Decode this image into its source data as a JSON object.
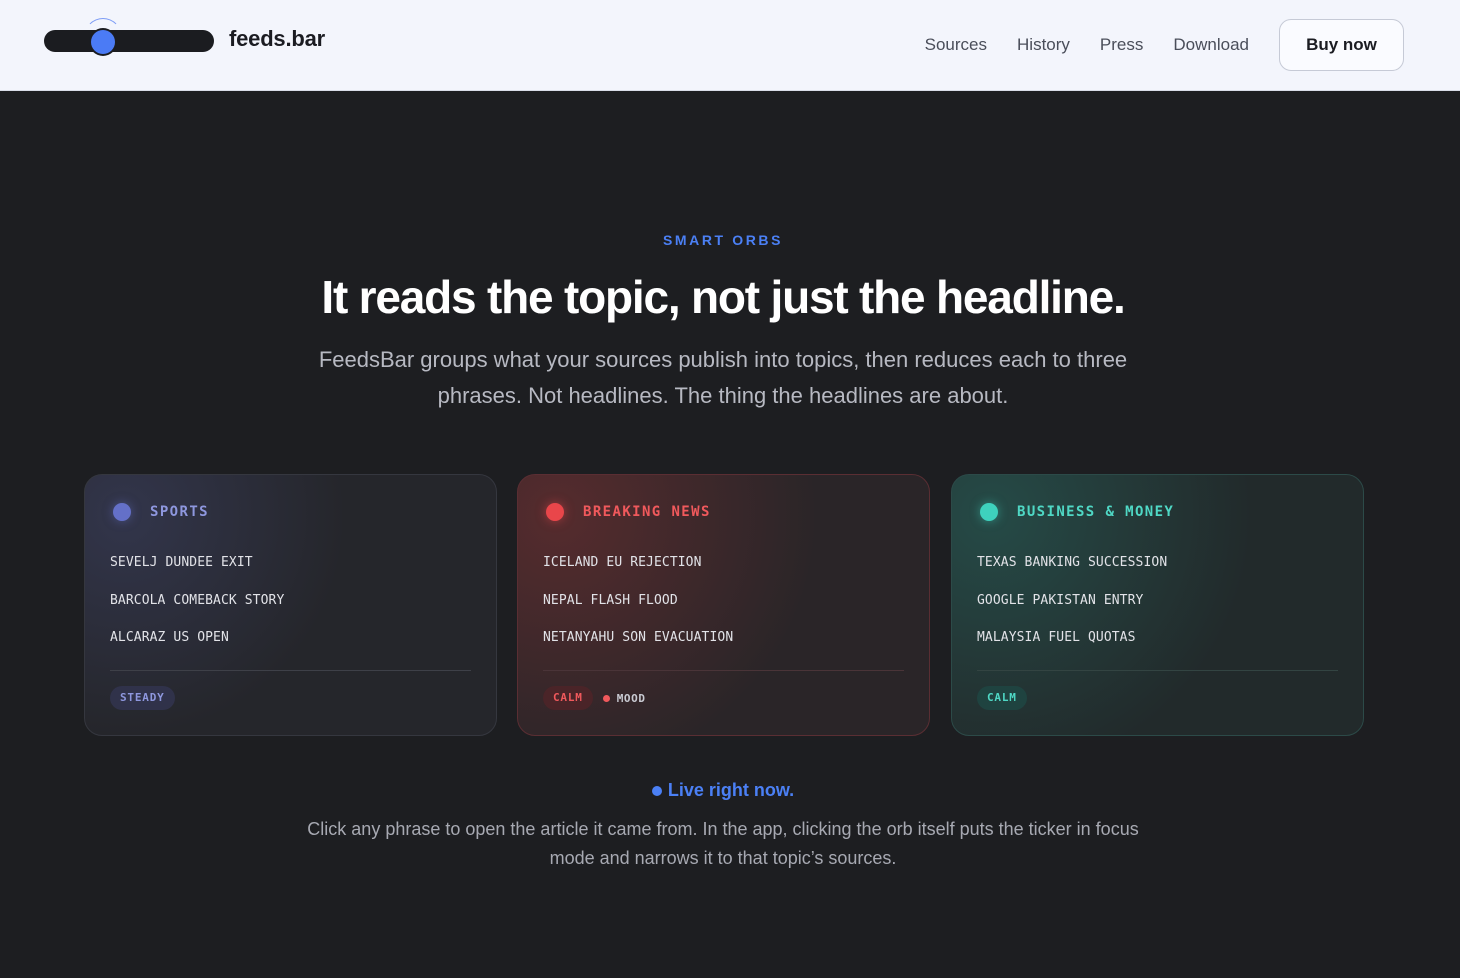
{
  "header": {
    "brand_name": "feeds.bar",
    "nav": [
      "Sources",
      "History",
      "Press",
      "Download"
    ],
    "cta": "Buy now"
  },
  "hero": {
    "eyebrow": "SMART ORBS",
    "headline": "It reads the topic, not just the headline.",
    "lede": "FeedsBar groups what your sources publish into topics, then reduces each to three phrases. Not headlines. The thing the headlines are about."
  },
  "cards": [
    {
      "title": "SPORTS",
      "orb_color": "#6470c8",
      "phrases": [
        "SEVELJ DUNDEE EXIT",
        "BARCOLA COMEBACK STORY",
        "ALCARAZ US OPEN"
      ],
      "status": "STEADY"
    },
    {
      "title": "BREAKING NEWS",
      "orb_color": "#e9464a",
      "phrases": [
        "ICELAND EU REJECTION",
        "NEPAL FLASH FLOOD",
        "NETANYAHU SON EVACUATION"
      ],
      "status": "CALM",
      "mood": "MOOD"
    },
    {
      "title": "BUSINESS & MONEY",
      "orb_color": "#3ed1bd",
      "phrases": [
        "TEXAS BANKING SUCCESSION",
        "GOOGLE PAKISTAN ENTRY",
        "MALAYSIA FUEL QUOTAS"
      ],
      "status": "CALM"
    }
  ],
  "footer": {
    "live": "Live right now.",
    "note": "Click any phrase to open the article it came from. In the app, clicking the orb itself puts the ticker in focus mode and narrows it to that topic’s sources."
  },
  "colors": {
    "accent": "#4b80f5",
    "background": "#1d1e21",
    "header_bg": "#f3f5fc"
  }
}
